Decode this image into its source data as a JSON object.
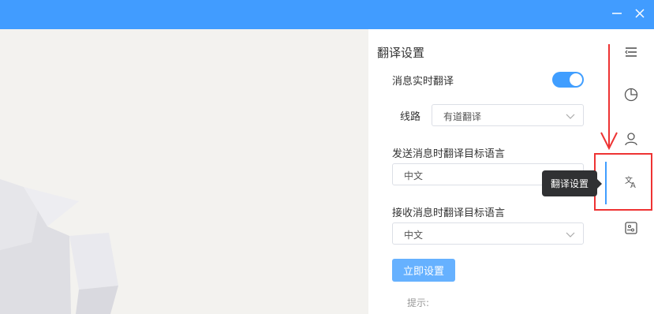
{
  "window": {
    "minimize_glyph": "—",
    "close_glyph": "✕"
  },
  "settings": {
    "title": "翻译设置",
    "realtime_label": "消息实时翻译",
    "realtime_enabled": true,
    "route_label": "线路",
    "route_value": "有道翻译",
    "send_lang_label": "发送消息时翻译目标语言",
    "send_lang_value": "中文",
    "recv_lang_label": "接收消息时翻译目标语言",
    "recv_lang_value": "中文",
    "apply_button": "立即设置",
    "hint": "提示:"
  },
  "sidebar": {
    "tooltip": "翻译设置",
    "items": [
      {
        "icon": "menu-collapse-icon"
      },
      {
        "icon": "pie-chart-icon"
      },
      {
        "icon": "user-icon"
      },
      {
        "icon": "translate-icon",
        "active": true
      },
      {
        "icon": "settings-panel-icon"
      }
    ]
  },
  "colors": {
    "titlebar": "#419cff",
    "accent": "#409eff",
    "annotation": "#e33333",
    "button": "#66b1ff",
    "tooltip_bg": "#303133",
    "canvas_bg": "#f3f2ef"
  }
}
